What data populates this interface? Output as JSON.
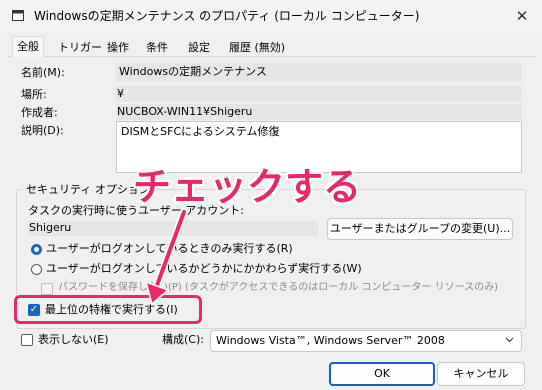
{
  "window": {
    "title": "Windowsの定期メンテナンス のプロパティ (ローカル コンピューター)",
    "close_symbol": "✕"
  },
  "tabs": [
    {
      "label": "全般",
      "active": true
    },
    {
      "label": "トリガー"
    },
    {
      "label": "操作"
    },
    {
      "label": "条件"
    },
    {
      "label": "設定"
    },
    {
      "label": "履歴 (無効)"
    }
  ],
  "general": {
    "name_label": "名前(M):",
    "name_value": "Windowsの定期メンテナンス",
    "location_label": "場所:",
    "location_value": "¥",
    "author_label": "作成者:",
    "author_value": "NUCBOX-WIN11¥Shigeru",
    "description_label": "説明(D):",
    "description_value": "DISMとSFCによるシステム修復"
  },
  "security": {
    "group_title": "セキュリティ オプション",
    "run_as_label": "タスクの実行時に使うユーザー アカウント:",
    "user_value": "Shigeru",
    "change_user_button": "ユーザーまたはグループの変更(U)...",
    "radio_logged_on": "ユーザーがログオンしているときのみ実行する(R)",
    "radio_whether": "ユーザーがログオンしているかどうかにかかわらず実行する(W)",
    "no_store_password": "パスワードを保存しない(P) (タスクがアクセスできるのはローカル コンピューター リソースのみ)",
    "highest_privileges": "最上位の特権で実行する(I)",
    "highest_privileges_checked": true
  },
  "bottom": {
    "hidden_label": "表示しない(E)",
    "configure_label": "構成(C):",
    "configure_value": "Windows Vista™, Windows Server™ 2008",
    "ok_button": "OK",
    "cancel_button": "キャンセル"
  },
  "annotation": {
    "callout_text": "チェックする",
    "accent_color": "#e8286a"
  },
  "colors": {
    "accent": "#1763c6",
    "highlight": "#e8286a"
  }
}
